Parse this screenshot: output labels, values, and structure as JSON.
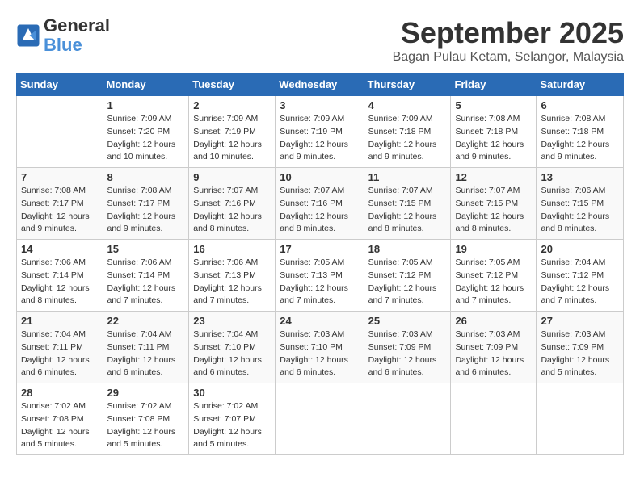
{
  "header": {
    "logo_line1": "General",
    "logo_line2": "Blue",
    "month_title": "September 2025",
    "subtitle": "Bagan Pulau Ketam, Selangor, Malaysia"
  },
  "days_of_week": [
    "Sunday",
    "Monday",
    "Tuesday",
    "Wednesday",
    "Thursday",
    "Friday",
    "Saturday"
  ],
  "weeks": [
    [
      {
        "day": "",
        "info": ""
      },
      {
        "day": "1",
        "info": "Sunrise: 7:09 AM\nSunset: 7:20 PM\nDaylight: 12 hours\nand 10 minutes."
      },
      {
        "day": "2",
        "info": "Sunrise: 7:09 AM\nSunset: 7:19 PM\nDaylight: 12 hours\nand 10 minutes."
      },
      {
        "day": "3",
        "info": "Sunrise: 7:09 AM\nSunset: 7:19 PM\nDaylight: 12 hours\nand 9 minutes."
      },
      {
        "day": "4",
        "info": "Sunrise: 7:09 AM\nSunset: 7:18 PM\nDaylight: 12 hours\nand 9 minutes."
      },
      {
        "day": "5",
        "info": "Sunrise: 7:08 AM\nSunset: 7:18 PM\nDaylight: 12 hours\nand 9 minutes."
      },
      {
        "day": "6",
        "info": "Sunrise: 7:08 AM\nSunset: 7:18 PM\nDaylight: 12 hours\nand 9 minutes."
      }
    ],
    [
      {
        "day": "7",
        "info": "Sunrise: 7:08 AM\nSunset: 7:17 PM\nDaylight: 12 hours\nand 9 minutes."
      },
      {
        "day": "8",
        "info": "Sunrise: 7:08 AM\nSunset: 7:17 PM\nDaylight: 12 hours\nand 9 minutes."
      },
      {
        "day": "9",
        "info": "Sunrise: 7:07 AM\nSunset: 7:16 PM\nDaylight: 12 hours\nand 8 minutes."
      },
      {
        "day": "10",
        "info": "Sunrise: 7:07 AM\nSunset: 7:16 PM\nDaylight: 12 hours\nand 8 minutes."
      },
      {
        "day": "11",
        "info": "Sunrise: 7:07 AM\nSunset: 7:15 PM\nDaylight: 12 hours\nand 8 minutes."
      },
      {
        "day": "12",
        "info": "Sunrise: 7:07 AM\nSunset: 7:15 PM\nDaylight: 12 hours\nand 8 minutes."
      },
      {
        "day": "13",
        "info": "Sunrise: 7:06 AM\nSunset: 7:15 PM\nDaylight: 12 hours\nand 8 minutes."
      }
    ],
    [
      {
        "day": "14",
        "info": "Sunrise: 7:06 AM\nSunset: 7:14 PM\nDaylight: 12 hours\nand 8 minutes."
      },
      {
        "day": "15",
        "info": "Sunrise: 7:06 AM\nSunset: 7:14 PM\nDaylight: 12 hours\nand 7 minutes."
      },
      {
        "day": "16",
        "info": "Sunrise: 7:06 AM\nSunset: 7:13 PM\nDaylight: 12 hours\nand 7 minutes."
      },
      {
        "day": "17",
        "info": "Sunrise: 7:05 AM\nSunset: 7:13 PM\nDaylight: 12 hours\nand 7 minutes."
      },
      {
        "day": "18",
        "info": "Sunrise: 7:05 AM\nSunset: 7:12 PM\nDaylight: 12 hours\nand 7 minutes."
      },
      {
        "day": "19",
        "info": "Sunrise: 7:05 AM\nSunset: 7:12 PM\nDaylight: 12 hours\nand 7 minutes."
      },
      {
        "day": "20",
        "info": "Sunrise: 7:04 AM\nSunset: 7:12 PM\nDaylight: 12 hours\nand 7 minutes."
      }
    ],
    [
      {
        "day": "21",
        "info": "Sunrise: 7:04 AM\nSunset: 7:11 PM\nDaylight: 12 hours\nand 6 minutes."
      },
      {
        "day": "22",
        "info": "Sunrise: 7:04 AM\nSunset: 7:11 PM\nDaylight: 12 hours\nand 6 minutes."
      },
      {
        "day": "23",
        "info": "Sunrise: 7:04 AM\nSunset: 7:10 PM\nDaylight: 12 hours\nand 6 minutes."
      },
      {
        "day": "24",
        "info": "Sunrise: 7:03 AM\nSunset: 7:10 PM\nDaylight: 12 hours\nand 6 minutes."
      },
      {
        "day": "25",
        "info": "Sunrise: 7:03 AM\nSunset: 7:09 PM\nDaylight: 12 hours\nand 6 minutes."
      },
      {
        "day": "26",
        "info": "Sunrise: 7:03 AM\nSunset: 7:09 PM\nDaylight: 12 hours\nand 6 minutes."
      },
      {
        "day": "27",
        "info": "Sunrise: 7:03 AM\nSunset: 7:09 PM\nDaylight: 12 hours\nand 5 minutes."
      }
    ],
    [
      {
        "day": "28",
        "info": "Sunrise: 7:02 AM\nSunset: 7:08 PM\nDaylight: 12 hours\nand 5 minutes."
      },
      {
        "day": "29",
        "info": "Sunrise: 7:02 AM\nSunset: 7:08 PM\nDaylight: 12 hours\nand 5 minutes."
      },
      {
        "day": "30",
        "info": "Sunrise: 7:02 AM\nSunset: 7:07 PM\nDaylight: 12 hours\nand 5 minutes."
      },
      {
        "day": "",
        "info": ""
      },
      {
        "day": "",
        "info": ""
      },
      {
        "day": "",
        "info": ""
      },
      {
        "day": "",
        "info": ""
      }
    ]
  ]
}
